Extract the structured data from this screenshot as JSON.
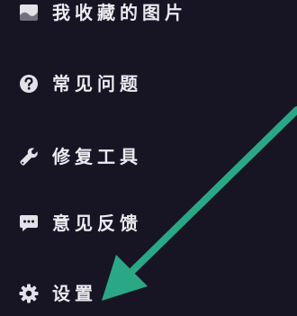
{
  "menu": {
    "items": [
      {
        "label": "我收藏的图片",
        "icon": "image-icon"
      },
      {
        "label": "常见问题",
        "icon": "question-circle-icon"
      },
      {
        "label": "修复工具",
        "icon": "wrench-icon"
      },
      {
        "label": "意见反馈",
        "icon": "chat-bubble-icon"
      },
      {
        "label": "设置",
        "icon": "gear-icon"
      }
    ]
  },
  "annotation": {
    "arrow_color": "#2aa886",
    "points_to": "设置"
  },
  "colors": {
    "background": "#171524",
    "text": "#ecebf0",
    "icon": "#e2e1e8"
  }
}
